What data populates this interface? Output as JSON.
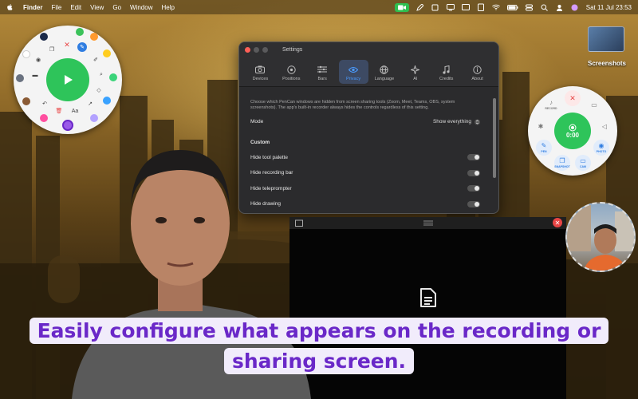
{
  "menubar": {
    "app_name": "Finder",
    "menus": [
      "File",
      "Edit",
      "View",
      "Go",
      "Window",
      "Help"
    ],
    "clock": "Sat 11 Jul  23:53"
  },
  "desktop": {
    "screenshots_label": "Screenshots"
  },
  "settings_window": {
    "title": "Settings",
    "tabs": [
      {
        "label": "Devices",
        "icon": "camera-icon"
      },
      {
        "label": "Positions",
        "icon": "target-icon"
      },
      {
        "label": "Bars",
        "icon": "sliders-icon"
      },
      {
        "label": "Privacy",
        "icon": "eye-icon",
        "active": true
      },
      {
        "label": "Language",
        "icon": "globe-icon"
      },
      {
        "label": "AI",
        "icon": "sparkle-icon"
      },
      {
        "label": "Credits",
        "icon": "music-note-icon"
      },
      {
        "label": "About",
        "icon": "info-icon"
      }
    ],
    "description": "Choose which PenCan windows are hidden from screen sharing tools (Zoom, Meet, Teams, OBS, system screenshots). The app's built-in recorder always hides the controls regardless of this setting.",
    "mode_label": "Mode",
    "mode_value": "Show everything",
    "section_custom": "Custom",
    "custom_rows": [
      {
        "label": "Hide tool palette",
        "on": false
      },
      {
        "label": "Hide recording bar",
        "on": false
      },
      {
        "label": "Hide teleprompter",
        "on": false
      },
      {
        "label": "Hide drawing",
        "on": false
      }
    ],
    "accent_color": "#4a9bff"
  },
  "recording_palette": {
    "timer": "0:00",
    "labels": {
      "record": "RECORD",
      "pen": "PEN",
      "snapshot": "SNAPSHOT",
      "cam": "CAM",
      "photo": "PHOTO"
    }
  },
  "caption": {
    "text": "Easily configure what appears on the recording or sharing screen."
  },
  "colors": {
    "play_green": "#2ec45a",
    "caption_purple": "#6a28c8",
    "close_red": "#e94545"
  }
}
